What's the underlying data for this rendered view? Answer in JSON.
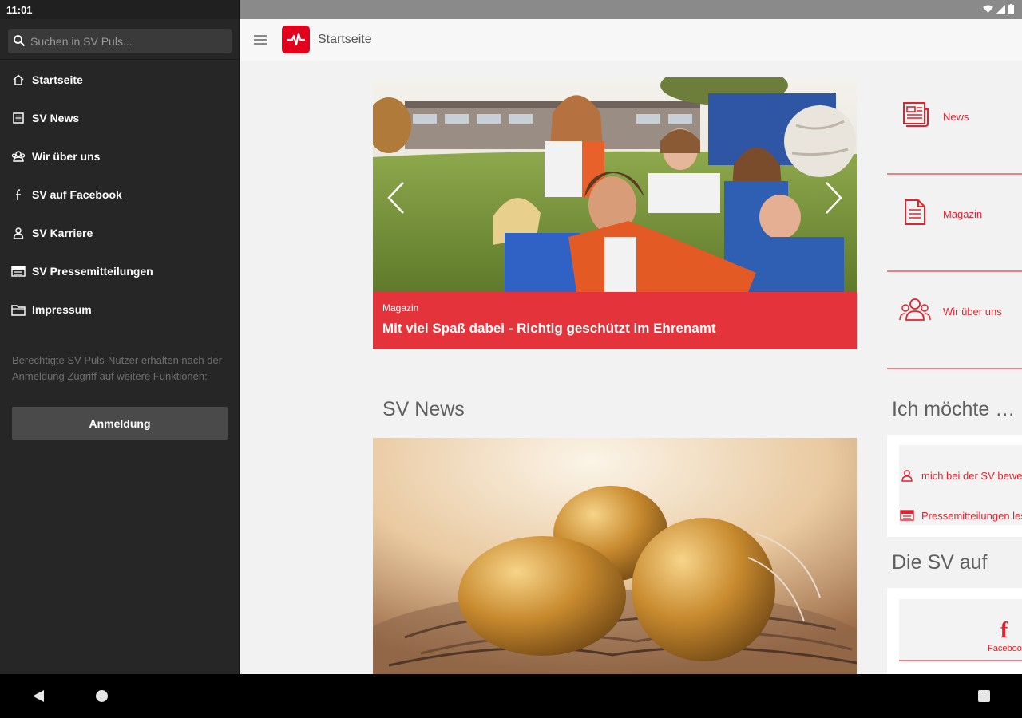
{
  "status": {
    "time": "11:01"
  },
  "drawer": {
    "search_placeholder": "Suchen in SV Puls...",
    "items": [
      {
        "label": "Startseite",
        "icon": "home-icon"
      },
      {
        "label": "SV News",
        "icon": "newspaper-icon"
      },
      {
        "label": "Wir über uns",
        "icon": "people-icon"
      },
      {
        "label": "SV auf Facebook",
        "icon": "facebook-icon"
      },
      {
        "label": "SV Karriere",
        "icon": "person-icon"
      },
      {
        "label": "SV Pressemitteilungen",
        "icon": "press-icon"
      },
      {
        "label": "Impressum",
        "icon": "folder-icon"
      }
    ],
    "note": "Berechtigte SV Puls-Nutzer erhalten nach der Anmeldung Zugriff auf weitere Funktionen:",
    "login_label": "Anmeldung"
  },
  "appbar": {
    "title": "Startseite"
  },
  "hero": {
    "tag": "Magazin",
    "title": "Mit viel Spaß dabei - Richtig geschützt im Ehrenamt"
  },
  "sections": {
    "news_title": "SV News",
    "want_title": "Ich möchte …",
    "social_title": "Die SV auf"
  },
  "tiles": [
    {
      "label": "News",
      "icon": "news-icon"
    },
    {
      "label": "Magazin",
      "icon": "magazine-icon"
    },
    {
      "label": "Wir über uns",
      "icon": "team-icon"
    }
  ],
  "want": [
    {
      "label": "mich bei der SV bewerben",
      "icon": "person-icon"
    },
    {
      "label": "Pressemitteilungen lesen",
      "icon": "press-icon"
    }
  ],
  "social": {
    "label": "Facebook"
  },
  "colors": {
    "brand_red": "#e3001b",
    "accent_red": "#e5333b",
    "drawer_bg": "#262626"
  }
}
